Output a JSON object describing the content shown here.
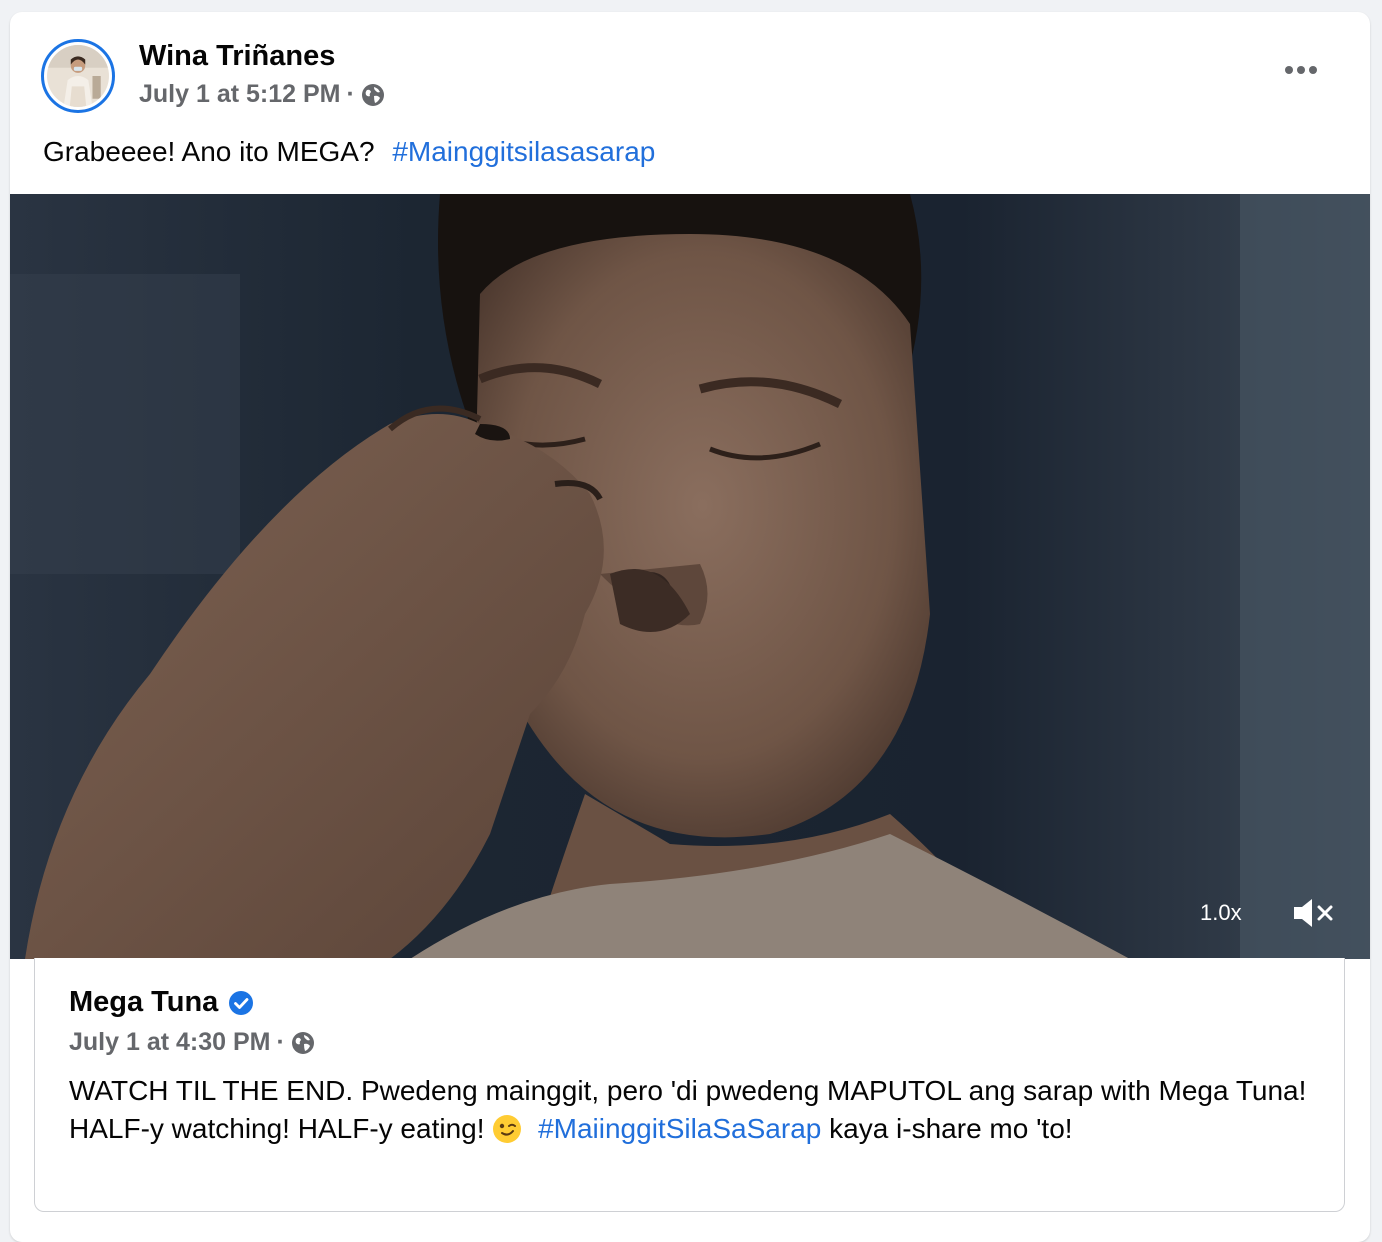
{
  "post": {
    "author": "Wina Triñanes",
    "timestamp": "July 1 at 5:12 PM",
    "separator": "·",
    "privacy_icon": "globe-icon",
    "more_icon": "more-options-icon",
    "text": "Grabeeee! Ano ito MEGA?",
    "hashtag": "#Mainggitsilasasarap"
  },
  "video": {
    "speed_label": "1.0x",
    "mute_icon": "volume-muted-icon"
  },
  "shared_post": {
    "author": "Mega Tuna",
    "verified_icon": "verified-badge-icon",
    "timestamp": "July 1 at 4:30 PM",
    "separator": "·",
    "privacy_icon": "globe-icon",
    "text_part1": "WATCH TIL THE END. Pwedeng mainggit, pero 'di pwedeng MAPUTOL ang sarap with Mega Tuna! HALF-y watching! HALF-y eating!",
    "emoji_icon": "winking-face-emoji",
    "hashtag": "#MaiinggitSilaSaSarap",
    "text_part2": "kaya i-share mo 'to!"
  },
  "colors": {
    "link": "#216fdb",
    "avatar_ring": "#1b74e4",
    "secondary_text": "#65676b",
    "page_background": "#f0f2f5"
  }
}
